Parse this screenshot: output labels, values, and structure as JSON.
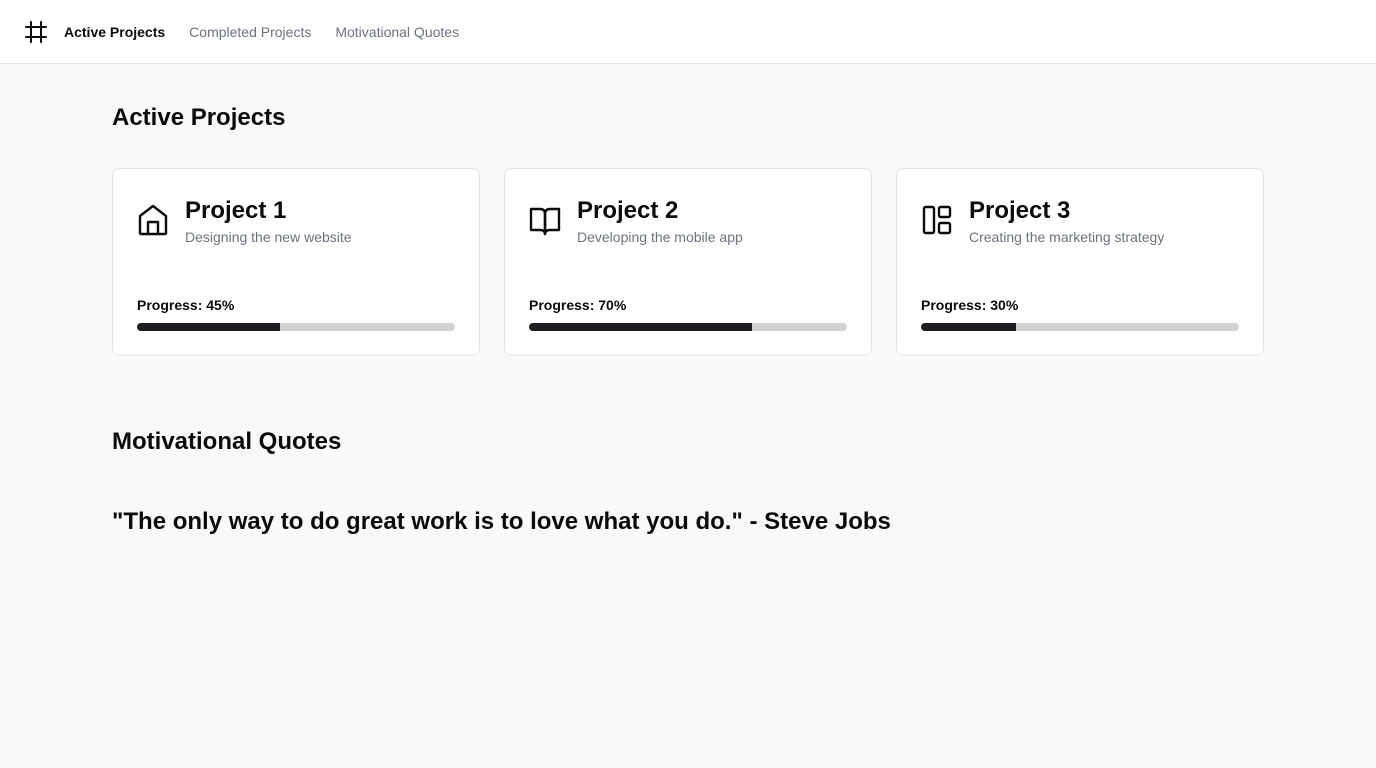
{
  "nav": {
    "logo_icon": "hash-icon",
    "items": [
      {
        "label": "Active Projects",
        "active": true
      },
      {
        "label": "Completed Projects",
        "active": false
      },
      {
        "label": "Motivational Quotes",
        "active": false
      }
    ]
  },
  "active_projects": {
    "heading": "Active Projects",
    "projects": [
      {
        "icon": "home-icon",
        "title": "Project 1",
        "description": "Designing the new website",
        "progress_label": "Progress: 45%",
        "progress": 45
      },
      {
        "icon": "book-open-icon",
        "title": "Project 2",
        "description": "Developing the mobile app",
        "progress_label": "Progress: 70%",
        "progress": 70
      },
      {
        "icon": "layout-icon",
        "title": "Project 3",
        "description": "Creating the marketing strategy",
        "progress_label": "Progress: 30%",
        "progress": 30
      }
    ]
  },
  "motivational_quotes": {
    "heading": "Motivational Quotes",
    "quote": "\"The only way to do great work is to love what you do.\" - Steve Jobs"
  },
  "colors": {
    "background": "#f8f9f8",
    "card": "#ffffff",
    "progress_fill": "#1c1d21",
    "progress_track": "#d1d2d4",
    "muted_text": "#6b7280"
  }
}
